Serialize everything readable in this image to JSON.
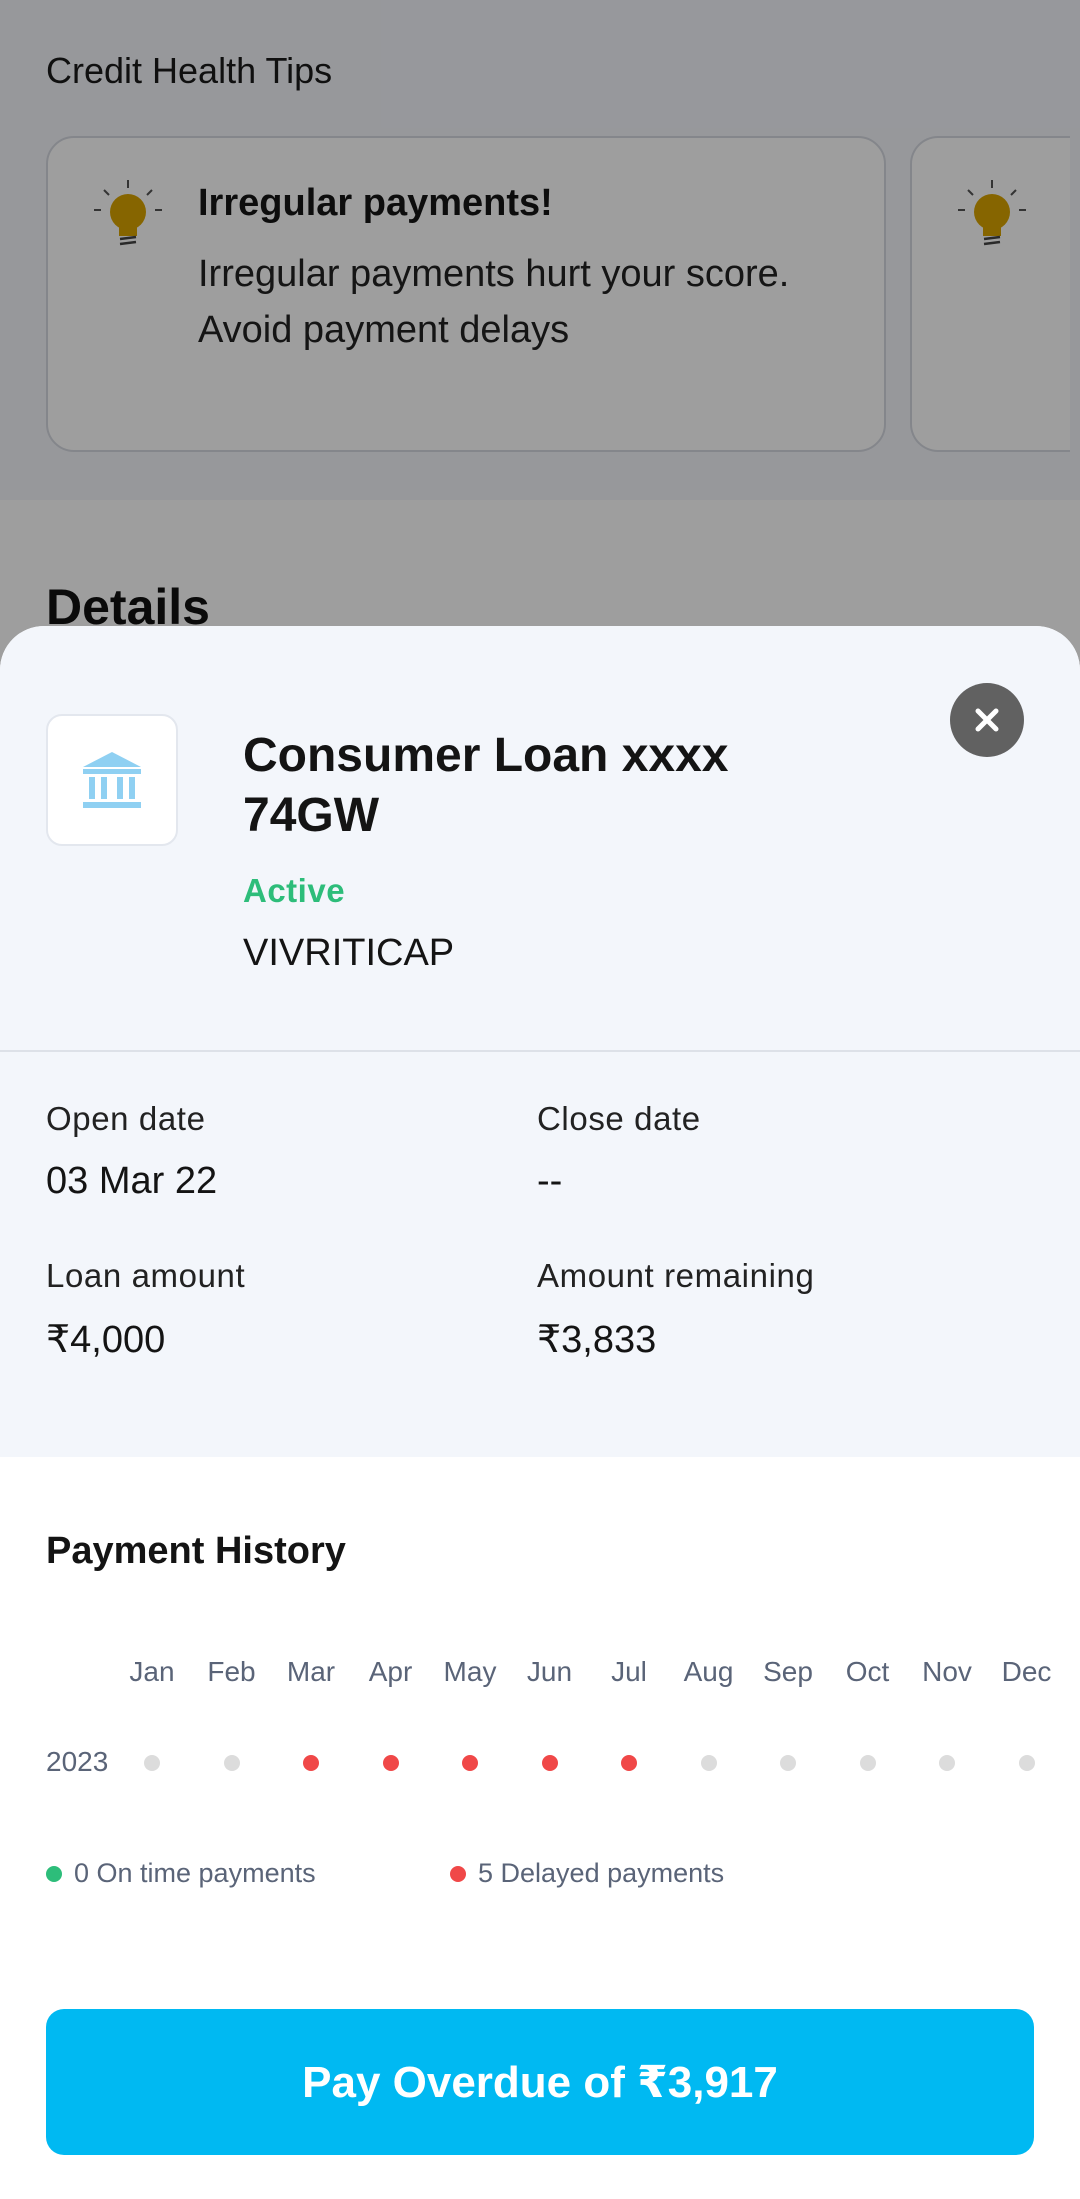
{
  "background": {
    "section_title": "Credit Health Tips",
    "tip": {
      "heading": "Irregular payments!",
      "body": "Irregular payments hurt your score. Avoid payment delays"
    },
    "details_title": "Details"
  },
  "sheet": {
    "loan_title": "Consumer Loan xxxx 74GW",
    "status": "Active",
    "lender": "VIVRITICAP",
    "fields": {
      "open_date_label": "Open date",
      "open_date_value": "03 Mar 22",
      "close_date_label": "Close date",
      "close_date_value": "--",
      "loan_amount_label": "Loan amount",
      "loan_amount_value": "₹4,000",
      "remaining_label": "Amount remaining",
      "remaining_value": "₹3,833"
    },
    "payment_history": {
      "title": "Payment History",
      "year": "2023",
      "months": [
        "Jan",
        "Feb",
        "Mar",
        "Apr",
        "May",
        "Jun",
        "Jul",
        "Aug",
        "Sep",
        "Oct",
        "Nov",
        "Dec"
      ],
      "statuses": [
        "none",
        "none",
        "delayed",
        "delayed",
        "delayed",
        "delayed",
        "delayed",
        "none",
        "none",
        "none",
        "none",
        "none"
      ],
      "legend_on_time": "0 On time payments",
      "legend_delayed": "5 Delayed payments"
    },
    "pay_button": "Pay Overdue of ₹3,917"
  },
  "colors": {
    "active": "#2dbd7a",
    "delayed": "#f04848",
    "no_data": "#dcdcdc",
    "on_time": "#2dbd7a",
    "primary_button": "#00b9f2",
    "bulb": "#d9a400"
  },
  "icons": {
    "close": "close-icon",
    "bank": "bank-icon",
    "tip": "lightbulb-icon"
  }
}
